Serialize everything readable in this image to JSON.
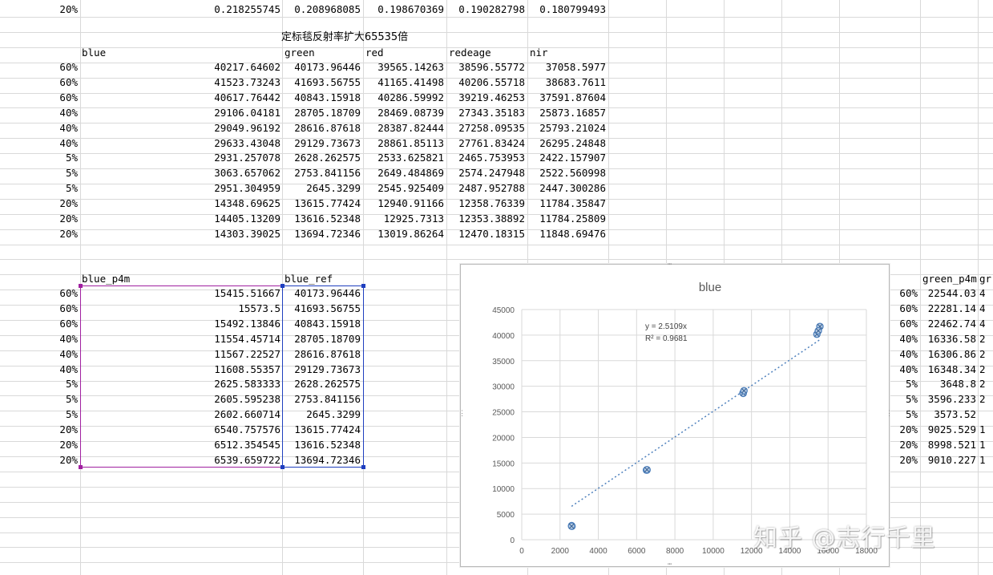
{
  "top_row": {
    "label": "20%",
    "values": [
      "0.218255745",
      "0.208968085",
      "0.198670369",
      "0.190282798",
      "0.180799493"
    ]
  },
  "table1": {
    "title": "定标毯反射率扩大65535倍",
    "headers": [
      "blue",
      "green",
      "red",
      "redeage",
      "nir"
    ],
    "rows": [
      {
        "label": "60%",
        "values": [
          "40217.64602",
          "40173.96446",
          "39565.14263",
          "38596.55772",
          "37058.5977"
        ]
      },
      {
        "label": "60%",
        "values": [
          "41523.73243",
          "41693.56755",
          "41165.41498",
          "40206.55718",
          "38683.7611"
        ]
      },
      {
        "label": "60%",
        "values": [
          "40617.76442",
          "40843.15918",
          "40286.59992",
          "39219.46253",
          "37591.87604"
        ]
      },
      {
        "label": "40%",
        "values": [
          "29106.04181",
          "28705.18709",
          "28469.08739",
          "27343.35183",
          "25873.16857"
        ]
      },
      {
        "label": "40%",
        "values": [
          "29049.96192",
          "28616.87618",
          "28387.82444",
          "27258.09535",
          "25793.21024"
        ]
      },
      {
        "label": "40%",
        "values": [
          "29633.43048",
          "29129.73673",
          "28861.85113",
          "27761.83424",
          "26295.24848"
        ]
      },
      {
        "label": "5%",
        "values": [
          "2931.257078",
          "2628.262575",
          "2533.625821",
          "2465.753953",
          "2422.157907"
        ]
      },
      {
        "label": "5%",
        "values": [
          "3063.657062",
          "2753.841156",
          "2649.484869",
          "2574.247948",
          "2522.560998"
        ]
      },
      {
        "label": "5%",
        "values": [
          "2951.304959",
          "2645.3299",
          "2545.925409",
          "2487.952788",
          "2447.300286"
        ]
      },
      {
        "label": "20%",
        "values": [
          "14348.69625",
          "13615.77424",
          "12940.91166",
          "12358.76339",
          "11784.35847"
        ]
      },
      {
        "label": "20%",
        "values": [
          "14405.13209",
          "13616.52348",
          "12925.7313",
          "12353.38892",
          "11784.25809"
        ]
      },
      {
        "label": "20%",
        "values": [
          "14303.39025",
          "13694.72346",
          "13019.86264",
          "12470.18315",
          "11848.69476"
        ]
      }
    ]
  },
  "table2": {
    "headers": [
      "blue_p4m",
      "blue_ref"
    ],
    "rows": [
      {
        "label": "60%",
        "values": [
          "15415.51667",
          "40173.96446"
        ]
      },
      {
        "label": "60%",
        "values": [
          "15573.5",
          "41693.56755"
        ]
      },
      {
        "label": "60%",
        "values": [
          "15492.13846",
          "40843.15918"
        ]
      },
      {
        "label": "40%",
        "values": [
          "11554.45714",
          "28705.18709"
        ]
      },
      {
        "label": "40%",
        "values": [
          "11567.22527",
          "28616.87618"
        ]
      },
      {
        "label": "40%",
        "values": [
          "11608.55357",
          "29129.73673"
        ]
      },
      {
        "label": "5%",
        "values": [
          "2625.583333",
          "2628.262575"
        ]
      },
      {
        "label": "5%",
        "values": [
          "2605.595238",
          "2753.841156"
        ]
      },
      {
        "label": "5%",
        "values": [
          "2602.660714",
          "2645.3299"
        ]
      },
      {
        "label": "20%",
        "values": [
          "6540.757576",
          "13615.77424"
        ]
      },
      {
        "label": "20%",
        "values": [
          "6512.354545",
          "13616.52348"
        ]
      },
      {
        "label": "20%",
        "values": [
          "6539.659722",
          "13694.72346"
        ]
      }
    ]
  },
  "table3": {
    "headers": [
      "green_p4m",
      "gr"
    ],
    "rows": [
      {
        "label": "60%",
        "values": [
          "22544.03",
          "4"
        ]
      },
      {
        "label": "60%",
        "values": [
          "22281.14",
          "4"
        ]
      },
      {
        "label": "60%",
        "values": [
          "22462.74",
          "4"
        ]
      },
      {
        "label": "40%",
        "values": [
          "16336.58",
          "2"
        ]
      },
      {
        "label": "40%",
        "values": [
          "16306.86",
          "2"
        ]
      },
      {
        "label": "40%",
        "values": [
          "16348.34",
          "2"
        ]
      },
      {
        "label": "5%",
        "values": [
          "3648.8",
          "2"
        ]
      },
      {
        "label": "5%",
        "values": [
          "3596.233",
          "2"
        ]
      },
      {
        "label": "5%",
        "values": [
          "3573.52",
          ""
        ]
      },
      {
        "label": "20%",
        "values": [
          "9025.529",
          "1"
        ]
      },
      {
        "label": "20%",
        "values": [
          "8998.521",
          "1"
        ]
      },
      {
        "label": "20%",
        "values": [
          "9010.227",
          "1"
        ]
      }
    ]
  },
  "chart_data": {
    "type": "scatter",
    "title": "blue",
    "xlim": [
      0,
      18000
    ],
    "ylim": [
      0,
      45000
    ],
    "x_ticks": [
      0,
      2000,
      4000,
      6000,
      8000,
      10000,
      12000,
      14000,
      16000,
      18000
    ],
    "y_ticks": [
      0,
      5000,
      10000,
      15000,
      20000,
      25000,
      30000,
      35000,
      40000,
      45000
    ],
    "grid": true,
    "legend": "none",
    "series": [
      {
        "x": [
          15415.51667,
          15573.5,
          15492.13846,
          11554.45714,
          11567.22527,
          11608.55357,
          2625.583333,
          2605.595238,
          2602.660714,
          6540.757576,
          6512.354545,
          6539.659722
        ],
        "y": [
          40173.96446,
          41693.56755,
          40843.15918,
          28705.18709,
          28616.87618,
          29129.73673,
          2628.262575,
          2753.841156,
          2645.3299,
          13615.77424,
          13616.52348,
          13694.72346
        ],
        "color": "#4f81bd"
      }
    ],
    "trendline": {
      "slope": 2.5109,
      "x_range": [
        2602.660714,
        15573.5
      ],
      "equation": "y = 2.5109x",
      "r2": "R² = 0.9681",
      "color": "#4f81bd"
    }
  },
  "watermark": "知乎 @志行千里",
  "colors": {
    "grid": "#d9d9d9",
    "selection_purple": "#a020a0",
    "selection_blue": "#1f3fbf",
    "series_blue": "#4f81bd"
  }
}
